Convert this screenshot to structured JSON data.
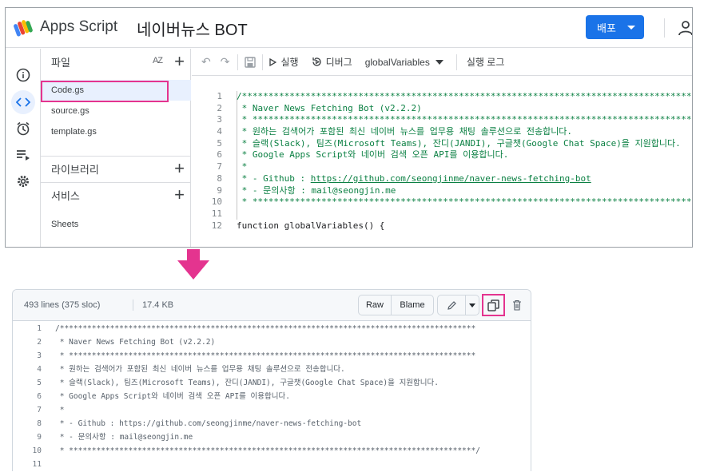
{
  "apps_script": {
    "product_name": "Apps Script",
    "project_title": "네이버뉴스 BOT",
    "deploy_label": "배포",
    "files_header": "파일",
    "sort_label": "AZ",
    "files": [
      "Code.gs",
      "source.gs",
      "template.gs"
    ],
    "selected_file": "Code.gs",
    "libraries_label": "라이브러리",
    "services_label": "서비스",
    "services": [
      "Sheets"
    ],
    "toolbar": {
      "run_label": "실행",
      "debug_label": "디버그",
      "function_select": "globalVariables",
      "log_label": "실행 로그"
    },
    "code_lines": [
      {
        "n": "1",
        "text": "/***********************************************************************************************************"
      },
      {
        "n": "2",
        "text": " * Naver News Fetching Bot (v2.2.2)"
      },
      {
        "n": "3",
        "text": " * *********************************************************************************************************"
      },
      {
        "n": "4",
        "text": " * 원하는 검색어가 포함된 최신 네이버 뉴스를 업무용 채팅 솔루션으로 전송합니다."
      },
      {
        "n": "5",
        "text": " * 슬랙(Slack), 팀즈(Microsoft Teams), 잔디(JANDI), 구글챗(Google Chat Space)을 지원합니다."
      },
      {
        "n": "6",
        "text": " * Google Apps Script와 네이버 검색 오픈 API를 이용합니다."
      },
      {
        "n": "7",
        "text": " *"
      },
      {
        "n": "8",
        "text": " * - Github : ",
        "link": "https://github.com/seongjinme/naver-news-fetching-bot"
      },
      {
        "n": "9",
        "text": " * - 문의사항 : mail@seongjin.me"
      },
      {
        "n": "10",
        "text": " * *********************************************************************************************************"
      },
      {
        "n": "11",
        "text": ""
      },
      {
        "n": "12",
        "text": "function globalVariables() {",
        "plain": true
      }
    ]
  },
  "github": {
    "lines_info": "493 lines (375 sloc)",
    "size_info": "17.4 KB",
    "raw_label": "Raw",
    "blame_label": "Blame",
    "code_lines": [
      {
        "n": "1",
        "text": "/*******************************************************************************************"
      },
      {
        "n": "2",
        "text": " * Naver News Fetching Bot (v2.2.2)"
      },
      {
        "n": "3",
        "text": " * *****************************************************************************************"
      },
      {
        "n": "4",
        "text": " * 원하는 검색어가 포함된 최신 네이버 뉴스를 업무용 채팅 솔루션으로 전송합니다."
      },
      {
        "n": "5",
        "text": " * 슬랙(Slack), 팀즈(Microsoft Teams), 잔디(JANDI), 구글챗(Google Chat Space)을 지원합니다."
      },
      {
        "n": "6",
        "text": " * Google Apps Script와 네이버 검색 오픈 API를 이용합니다."
      },
      {
        "n": "7",
        "text": " *"
      },
      {
        "n": "8",
        "text": " * - Github : https://github.com/seongjinme/naver-news-fetching-bot"
      },
      {
        "n": "9",
        "text": " * - 문의사항 : mail@seongjin.me"
      },
      {
        "n": "10",
        "text": " * *****************************************************************************************/"
      },
      {
        "n": "11",
        "text": ""
      }
    ]
  },
  "colors": {
    "highlight": "#e4348f",
    "deploy_blue": "#1a73e8",
    "comment_green": "#0b8043"
  },
  "icons": [
    "apps-script-logo",
    "info-icon",
    "code-icon",
    "clock-icon",
    "list-run-icon",
    "gear-icon",
    "undo-icon",
    "redo-icon",
    "save-icon",
    "debug-icon",
    "account-icon",
    "pencil-icon",
    "copy-icon",
    "trash-icon",
    "down-arrow"
  ]
}
